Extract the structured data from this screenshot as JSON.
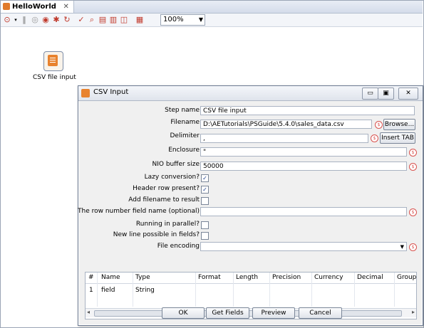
{
  "editor": {
    "tab_title": "HelloWorld",
    "zoom": "100%"
  },
  "canvas": {
    "step_label": "CSV file input"
  },
  "dialog": {
    "title": "CSV Input",
    "fields": {
      "step_name": {
        "label": "Step name",
        "value": "CSV file input"
      },
      "filename": {
        "label": "Filename",
        "value": "D:\\AETutorials\\PSGuide\\5.4.0\\sales_data.csv"
      },
      "delimiter": {
        "label": "Delimiter",
        "value": ","
      },
      "enclosure": {
        "label": "Enclosure",
        "value": "\""
      },
      "nio_buffer": {
        "label": "NIO buffer size",
        "value": "50000"
      },
      "lazy_conversion": {
        "label": "Lazy conversion?",
        "checked": true
      },
      "header_row": {
        "label": "Header row present?",
        "checked": true
      },
      "add_filename": {
        "label": "Add filename to result",
        "checked": false
      },
      "row_number_field": {
        "label": "The row number field name (optional)",
        "value": ""
      },
      "running_parallel": {
        "label": "Running in parallel?",
        "checked": false
      },
      "new_line_fields": {
        "label": "New line possible in fields?",
        "checked": false
      },
      "file_encoding": {
        "label": "File encoding",
        "value": ""
      }
    },
    "side_buttons": {
      "browse": "Browse...",
      "insert_tab": "Insert TAB"
    },
    "table": {
      "columns": [
        "#",
        "Name",
        "Type",
        "Format",
        "Length",
        "Precision",
        "Currency",
        "Decimal",
        "Group"
      ],
      "rows": [
        [
          "1",
          "field",
          "String",
          "",
          "",
          "",
          "",
          "",
          ""
        ]
      ]
    },
    "buttons": {
      "ok": "OK",
      "get_fields": "Get Fields",
      "preview": "Preview",
      "cancel": "Cancel"
    }
  }
}
